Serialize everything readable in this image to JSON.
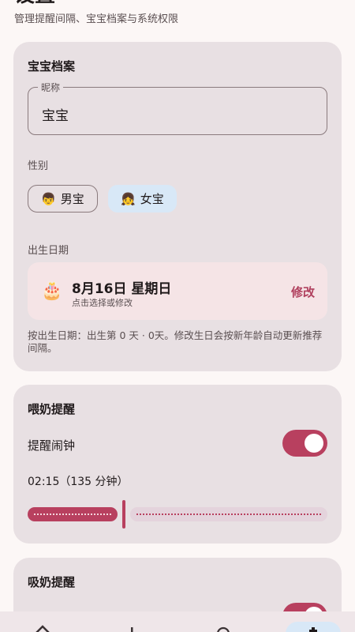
{
  "header": {
    "title": "设置",
    "subtitle": "管理提醒间隔、宝宝档案与系统权限"
  },
  "profile": {
    "title": "宝宝档案",
    "nickname_label": "昵称",
    "nickname_value": "宝宝",
    "gender_label": "性别",
    "gender_options": [
      {
        "emoji": "👦",
        "label": "男宝",
        "selected": false
      },
      {
        "emoji": "👧",
        "label": "女宝",
        "selected": true
      }
    ],
    "birth_label": "出生日期",
    "birth_icon": "🎂",
    "birth_date": "8月16日 星期日",
    "birth_hint": "点击选择或修改",
    "edit_label": "修改",
    "note": "按出生日期：出生第 0 天 · 0天。修改生日会按新年龄自动更新推荐间隔。"
  },
  "feeding": {
    "title": "喂奶提醒",
    "alarm_label": "提醒闹钟",
    "alarm_enabled": true,
    "interval_text": "02:15（135 分钟）",
    "interval_minutes": 135,
    "slider_fraction": 0.31
  },
  "pumping": {
    "title": "吸奶提醒",
    "alarm_enabled": true
  },
  "colors": {
    "accent": "#b8405f",
    "card": "#e8e0e3",
    "selected_chip": "#d8e8f7"
  },
  "nav": {
    "items": [
      "home-icon",
      "add-icon",
      "search-icon",
      "settings-icon"
    ],
    "active": "settings-icon"
  }
}
